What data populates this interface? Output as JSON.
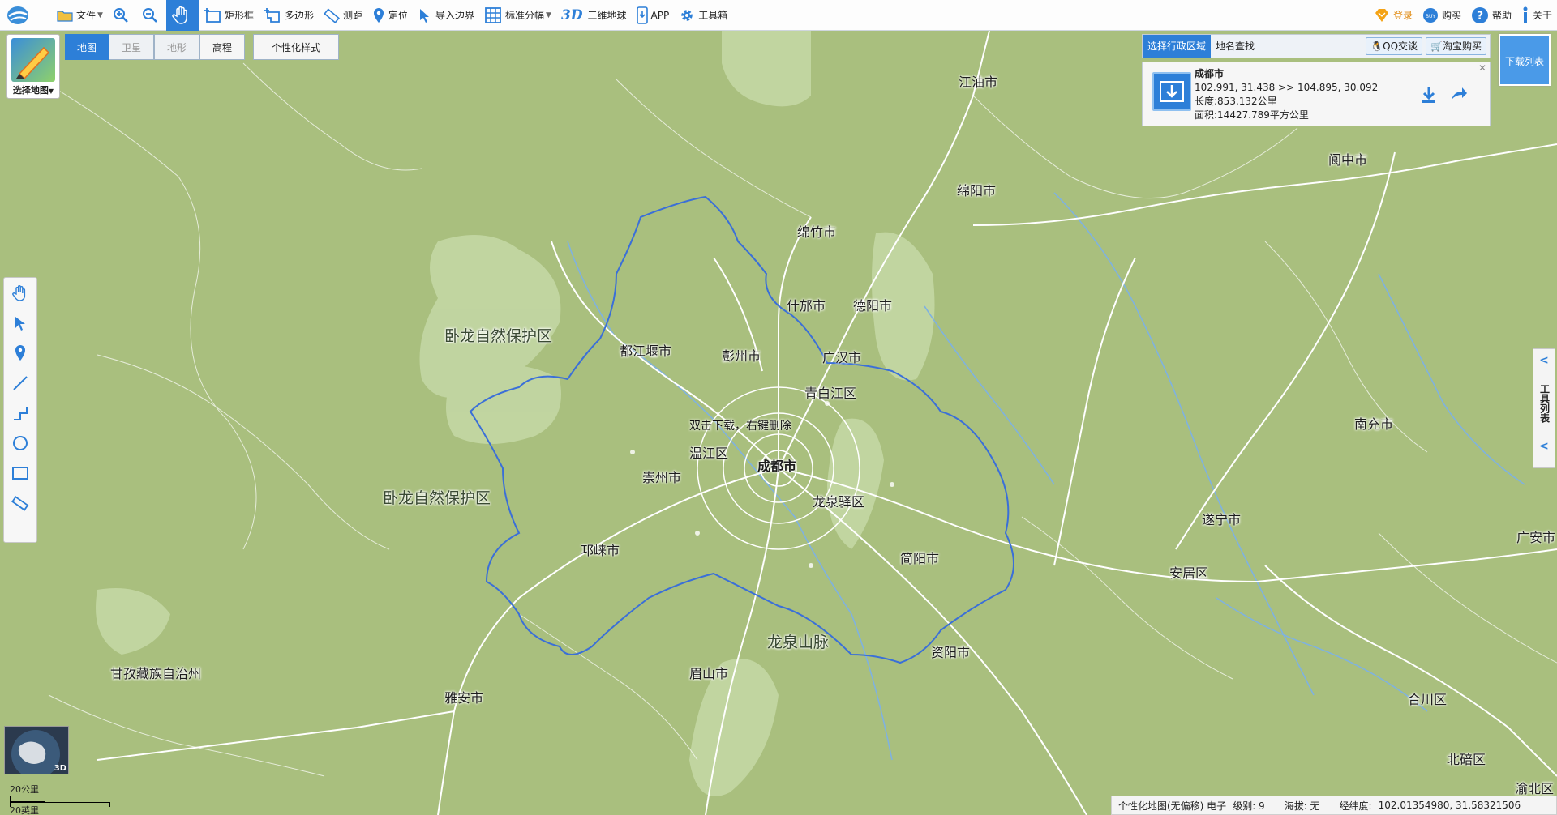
{
  "toolbar": {
    "items": [
      {
        "label": "文件",
        "icon": "folder-icon"
      },
      {
        "label": "",
        "icon": "zoom-in-icon"
      },
      {
        "label": "",
        "icon": "zoom-out-icon"
      },
      {
        "label": "",
        "icon": "pan-hand-icon"
      },
      {
        "label": "矩形框",
        "icon": "rectangle-select-icon"
      },
      {
        "label": "多边形",
        "icon": "polygon-select-icon"
      },
      {
        "label": "测距",
        "icon": "ruler-icon"
      },
      {
        "label": "定位",
        "icon": "location-pin-icon"
      },
      {
        "label": "导入边界",
        "icon": "import-boundary-icon"
      },
      {
        "label": "标准分幅",
        "icon": "grid-icon"
      },
      {
        "label": "三维地球",
        "icon": "3d-globe-icon",
        "badge": "3D"
      },
      {
        "label": "APP",
        "icon": "phone-download-icon"
      },
      {
        "label": "工具箱",
        "icon": "gear-icon"
      }
    ],
    "right": [
      {
        "label": "登录",
        "icon": "login-diamond-icon"
      },
      {
        "label": "购买",
        "icon": "buy-icon"
      },
      {
        "label": "帮助",
        "icon": "help-icon"
      },
      {
        "label": "关于",
        "icon": "info-icon"
      }
    ]
  },
  "map_selector": {
    "label": "选择地图"
  },
  "map_types": [
    "地图",
    "卫星",
    "地形",
    "高程",
    "个性化样式"
  ],
  "right_panel": {
    "tabs": [
      "选择行政区域",
      "地名查找"
    ],
    "qq": "QQ交谈",
    "taobao": "淘宝购买",
    "download_list": "下载列表",
    "info": {
      "city": "成都市",
      "coords": "102.991, 31.438 >> 104.895, 30.092",
      "length": "长度:853.132公里",
      "area": "面积:14427.789平方公里"
    }
  },
  "right_tool_list": "工具列表",
  "hint": "双击下载，右键删除",
  "places": [
    {
      "name": "江油市"
    },
    {
      "name": "绵阳市"
    },
    {
      "name": "阆中市"
    },
    {
      "name": "绵竹市"
    },
    {
      "name": "什邡市"
    },
    {
      "name": "德阳市"
    },
    {
      "name": "都江堰市"
    },
    {
      "name": "彭州市"
    },
    {
      "name": "广汉市"
    },
    {
      "name": "青白江区"
    },
    {
      "name": "温江区"
    },
    {
      "name": "成都市"
    },
    {
      "name": "崇州市"
    },
    {
      "name": "龙泉驿区"
    },
    {
      "name": "邛崃市"
    },
    {
      "name": "简阳市"
    },
    {
      "name": "遂宁市"
    },
    {
      "name": "南充市"
    },
    {
      "name": "安居区"
    },
    {
      "name": "广安市"
    },
    {
      "name": "龙泉山脉"
    },
    {
      "name": "资阳市"
    },
    {
      "name": "眉山市"
    },
    {
      "name": "雅安市"
    },
    {
      "name": "甘孜藏族自治州"
    },
    {
      "name": "合川区"
    },
    {
      "name": "北碚区"
    },
    {
      "name": "渝北区"
    },
    {
      "name": "卧龙自然保护区"
    },
    {
      "name": "卧龙自然保护区"
    }
  ],
  "scale": {
    "km": "20公里",
    "mi": "20英里"
  },
  "minimap_label": "3D",
  "status": {
    "source": "个性化地图(无偏移) 电子",
    "level": "级别:  9",
    "altitude": "海拔: 无",
    "lnglat_label": "经纬度:",
    "lnglat": "102.01354980, 31.58321506"
  },
  "colors": {
    "accent": "#2d7fd8",
    "map_bg": "#a9bf7e",
    "boundary": "#3a6fd8",
    "road": "#ffffff"
  }
}
